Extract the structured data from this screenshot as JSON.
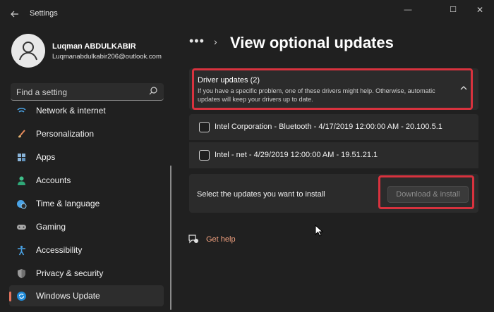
{
  "window": {
    "title": "Settings",
    "minimize": "—",
    "maximize": "☐",
    "close": "✕"
  },
  "profile": {
    "name": "Luqman ABDULKABIR",
    "email": "Luqmanabdulkabir206@outlook.com"
  },
  "search": {
    "placeholder": "Find a setting"
  },
  "sidebar": {
    "items": [
      {
        "label": "Network & internet",
        "icon": "network-icon",
        "active": false
      },
      {
        "label": "Personalization",
        "icon": "brush-icon",
        "active": false
      },
      {
        "label": "Apps",
        "icon": "apps-icon",
        "active": false
      },
      {
        "label": "Accounts",
        "icon": "person-icon",
        "active": false
      },
      {
        "label": "Time & language",
        "icon": "globe-clock-icon",
        "active": false
      },
      {
        "label": "Gaming",
        "icon": "gamepad-icon",
        "active": false
      },
      {
        "label": "Accessibility",
        "icon": "accessibility-icon",
        "active": false
      },
      {
        "label": "Privacy & security",
        "icon": "shield-icon",
        "active": false
      },
      {
        "label": "Windows Update",
        "icon": "sync-icon",
        "active": true
      }
    ]
  },
  "breadcrumb": {
    "dots": "•••",
    "separator": "›",
    "title": "View optional updates"
  },
  "driver_updates": {
    "title": "Driver updates (2)",
    "description": "If you have a specific problem, one of these drivers might help. Otherwise, automatic updates will keep your drivers up to date.",
    "expanded": true,
    "items": [
      {
        "label": "Intel Corporation - Bluetooth - 4/17/2019 12:00:00 AM - 20.100.5.1",
        "checked": false
      },
      {
        "label": "Intel - net - 4/29/2019 12:00:00 AM - 19.51.21.1",
        "checked": false
      }
    ]
  },
  "action": {
    "prompt": "Select the updates you want to install",
    "button_label": "Download & install",
    "button_enabled": false
  },
  "help": {
    "label": "Get help"
  },
  "colors": {
    "accent": "#e3735e",
    "highlight_box": "#d8323e",
    "link": "#f0a07e"
  }
}
